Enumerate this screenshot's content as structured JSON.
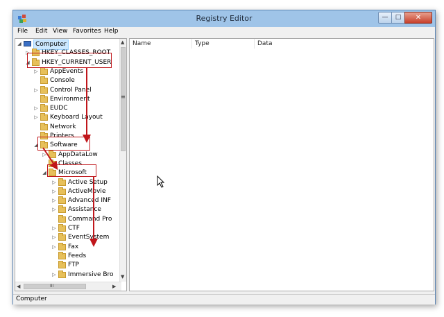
{
  "window": {
    "title": "Registry Editor"
  },
  "window_buttons": {
    "minimize": "—",
    "maximize": "□",
    "close": "✕"
  },
  "menu": [
    "File",
    "Edit",
    "View",
    "Favorites",
    "Help"
  ],
  "tree": [
    {
      "label": "Computer",
      "expander": "◢",
      "icon": "computer-icon"
    },
    {
      "label": "HKEY_CLASSES_ROOT",
      "expander": "▷",
      "icon": "folder-icon"
    },
    {
      "label": "HKEY_CURRENT_USER",
      "expander": "◢",
      "icon": "folder-icon"
    },
    {
      "label": "AppEvents",
      "expander": "▷",
      "icon": "folder-icon"
    },
    {
      "label": "Console",
      "expander": "",
      "icon": "folder-icon"
    },
    {
      "label": "Control Panel",
      "expander": "▷",
      "icon": "folder-icon"
    },
    {
      "label": "Environment",
      "expander": "",
      "icon": "folder-icon"
    },
    {
      "label": "EUDC",
      "expander": "▷",
      "icon": "folder-icon"
    },
    {
      "label": "Keyboard Layout",
      "expander": "▷",
      "icon": "folder-icon"
    },
    {
      "label": "Network",
      "expander": "",
      "icon": "folder-icon"
    },
    {
      "label": "Printers",
      "expander": "",
      "icon": "folder-icon"
    },
    {
      "label": "Software",
      "expander": "◢",
      "icon": "folder-icon"
    },
    {
      "label": "AppDataLow",
      "expander": "▷",
      "icon": "folder-icon"
    },
    {
      "label": "Classes",
      "expander": "",
      "icon": "folder-icon"
    },
    {
      "label": "Microsoft",
      "expander": "◢",
      "icon": "folder-icon"
    },
    {
      "label": "Active Setup",
      "expander": "▷",
      "icon": "folder-icon"
    },
    {
      "label": "ActiveMovie",
      "expander": "▷",
      "icon": "folder-icon"
    },
    {
      "label": "Advanced INF",
      "expander": "▷",
      "icon": "folder-icon"
    },
    {
      "label": "Assistance",
      "expander": "▷",
      "icon": "folder-icon"
    },
    {
      "label": "Command Pro",
      "expander": "",
      "icon": "folder-icon"
    },
    {
      "label": "CTF",
      "expander": "▷",
      "icon": "folder-icon"
    },
    {
      "label": "EventSystem",
      "expander": "▷",
      "icon": "folder-icon"
    },
    {
      "label": "Fax",
      "expander": "▷",
      "icon": "folder-icon"
    },
    {
      "label": "Feeds",
      "expander": "",
      "icon": "folder-icon"
    },
    {
      "label": "FTP",
      "expander": "",
      "icon": "folder-icon"
    },
    {
      "label": "Immersive Bro",
      "expander": "▷",
      "icon": "folder-icon"
    }
  ],
  "list_columns": [
    "Name",
    "Type",
    "Data"
  ],
  "status": {
    "path": "Computer"
  },
  "scroll": {
    "up": "▲",
    "down": "▼",
    "left": "◀",
    "right": "▶",
    "grip": "≡",
    "hgrip": "III"
  },
  "colors": {
    "highlight": "#c0161b",
    "titlebar": "#9fc4e8",
    "folder": "#e7c05a"
  }
}
